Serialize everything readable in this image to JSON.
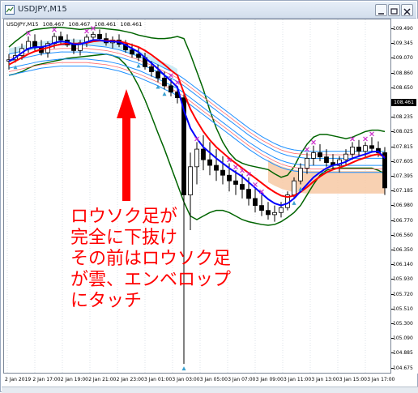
{
  "window": {
    "title": "USDJPY,M15",
    "ohlc": [
      "USDJPY,M15",
      "108.467",
      "108.467",
      "108.461",
      "108.461"
    ]
  },
  "colors": {
    "ma_fast": "#0000ff",
    "ma_slow": "#ff0000",
    "envelope_outer": "#1e90ff",
    "envelope_inner": "#ff7070",
    "bollinger": "#006400",
    "kumo_up": "#c6eaf4",
    "kumo_down": "#f7c9a4",
    "candle": "#000000",
    "arrow_up": "#ff0000",
    "fractal": "#cc33cc",
    "annotation": "#ff0000"
  },
  "y_axis": {
    "labels": [
      "109.490",
      "109.345",
      "109.070",
      "108.860",
      "108.650",
      "108.461",
      "108.235",
      "108.025",
      "107.815",
      "107.605",
      "107.395",
      "107.185",
      "106.980",
      "106.770",
      "106.560",
      "106.350",
      "106.140",
      "105.930",
      "105.720",
      "105.510",
      "105.300",
      "105.090",
      "104.885",
      "104.675"
    ],
    "current_price": "108.461"
  },
  "x_axis": {
    "labels": [
      "2 Jan 2019",
      "2 Jan 17:00",
      "2 Jan 19:00",
      "2 Jan 21:00",
      "2 Jan 23:00",
      "3 Jan 01:00",
      "3 Jan 03:00",
      "3 Jan 05:00",
      "3 Jan 07:00",
      "3 Jan 09:00",
      "3 Jan 11:00",
      "3 Jan 13:00",
      "3 Jan 15:00",
      "3 Jan 17:00"
    ]
  },
  "annotation": {
    "lines": [
      "ロウソク足が",
      "完全に下抜け",
      "その前はロウソク足",
      "が雲、エンベロップ",
      "にタッチ"
    ]
  },
  "chart_data": {
    "type": "candlestick",
    "symbol": "USDJPY",
    "timeframe": "M15",
    "ylim": [
      104.675,
      109.6
    ],
    "x_tick_labels": [
      "2 Jan 2019",
      "2 Jan 17:00",
      "2 Jan 19:00",
      "2 Jan 21:00",
      "2 Jan 23:00",
      "3 Jan 01:00",
      "3 Jan 03:00",
      "3 Jan 05:00",
      "3 Jan 07:00",
      "3 Jan 09:00",
      "3 Jan 11:00",
      "3 Jan 13:00",
      "3 Jan 15:00",
      "3 Jan 17:00"
    ],
    "candles": [
      [
        109.1,
        109.2,
        108.98,
        109.12
      ],
      [
        109.12,
        109.3,
        109.08,
        109.18
      ],
      [
        109.18,
        109.35,
        109.12,
        109.28
      ],
      [
        109.28,
        109.45,
        109.22,
        109.38
      ],
      [
        109.38,
        109.48,
        109.25,
        109.3
      ],
      [
        109.3,
        109.4,
        109.18,
        109.22
      ],
      [
        109.22,
        109.38,
        109.15,
        109.35
      ],
      [
        109.35,
        109.5,
        109.28,
        109.45
      ],
      [
        109.45,
        109.52,
        109.35,
        109.4
      ],
      [
        109.4,
        109.48,
        109.3,
        109.33
      ],
      [
        109.33,
        109.42,
        109.2,
        109.25
      ],
      [
        109.25,
        109.4,
        109.18,
        109.36
      ],
      [
        109.36,
        109.48,
        109.3,
        109.44
      ],
      [
        109.44,
        109.52,
        109.38,
        109.48
      ],
      [
        109.48,
        109.55,
        109.4,
        109.42
      ],
      [
        109.42,
        109.5,
        109.32,
        109.36
      ],
      [
        109.36,
        109.45,
        109.28,
        109.4
      ],
      [
        109.4,
        109.48,
        109.3,
        109.34
      ],
      [
        109.34,
        109.4,
        109.22,
        109.26
      ],
      [
        109.26,
        109.35,
        109.15,
        109.2
      ],
      [
        109.2,
        109.3,
        109.1,
        109.15
      ],
      [
        109.15,
        109.22,
        108.98,
        109.02
      ],
      [
        109.02,
        109.1,
        108.88,
        108.95
      ],
      [
        108.95,
        109.05,
        108.8,
        108.86
      ],
      [
        108.86,
        108.95,
        108.7,
        108.75
      ],
      [
        108.75,
        108.85,
        108.6,
        108.66
      ],
      [
        108.66,
        108.75,
        108.5,
        108.58
      ],
      [
        108.58,
        108.65,
        104.8,
        107.2
      ],
      [
        107.2,
        107.8,
        106.7,
        107.6
      ],
      [
        107.6,
        107.95,
        107.35,
        107.85
      ],
      [
        107.85,
        108.05,
        107.55,
        107.7
      ],
      [
        107.7,
        107.95,
        107.48,
        107.62
      ],
      [
        107.62,
        107.85,
        107.4,
        107.55
      ],
      [
        107.55,
        107.75,
        107.35,
        107.48
      ],
      [
        107.48,
        107.65,
        107.25,
        107.4
      ],
      [
        107.4,
        107.55,
        107.2,
        107.35
      ],
      [
        107.35,
        107.5,
        107.15,
        107.28
      ],
      [
        107.28,
        107.45,
        107.05,
        107.15
      ],
      [
        107.15,
        107.3,
        106.95,
        107.05
      ],
      [
        107.05,
        107.2,
        106.9,
        106.98
      ],
      [
        106.98,
        107.1,
        106.85,
        106.92
      ],
      [
        106.92,
        107.05,
        106.82,
        106.95
      ],
      [
        106.95,
        107.1,
        106.88,
        107.02
      ],
      [
        107.02,
        107.25,
        106.98,
        107.2
      ],
      [
        107.2,
        107.45,
        107.15,
        107.4
      ],
      [
        107.4,
        107.65,
        107.35,
        107.58
      ],
      [
        107.58,
        107.8,
        107.5,
        107.72
      ],
      [
        107.72,
        107.9,
        107.62,
        107.8
      ],
      [
        107.8,
        107.92,
        107.68,
        107.74
      ],
      [
        107.74,
        107.85,
        107.6,
        107.66
      ],
      [
        107.66,
        107.78,
        107.55,
        107.62
      ],
      [
        107.62,
        107.75,
        107.52,
        107.7
      ],
      [
        107.7,
        107.85,
        107.62,
        107.78
      ],
      [
        107.78,
        107.95,
        107.7,
        107.88
      ],
      [
        107.88,
        107.98,
        107.75,
        107.82
      ],
      [
        107.82,
        107.95,
        107.72,
        107.9
      ],
      [
        107.9,
        108.02,
        107.8,
        107.86
      ],
      [
        107.86,
        107.96,
        107.74,
        107.8
      ],
      [
        107.8,
        107.88,
        107.2,
        107.3
      ]
    ],
    "series": [
      {
        "role": "ma_fast",
        "values": [
          109.1,
          109.15,
          109.22,
          109.28,
          109.3,
          109.3,
          109.32,
          109.36,
          109.38,
          109.37,
          109.34,
          109.34,
          109.37,
          109.4,
          109.4,
          109.38,
          109.38,
          109.37,
          109.33,
          109.28,
          109.23,
          109.15,
          109.07,
          108.99,
          108.9,
          108.82,
          108.73,
          108.4,
          108.15,
          108.0,
          107.88,
          107.8,
          107.72,
          107.65,
          107.58,
          107.52,
          107.46,
          107.38,
          107.3,
          107.22,
          107.14,
          107.08,
          107.05,
          107.08,
          107.15,
          107.25,
          107.35,
          107.45,
          107.52,
          107.58,
          107.62,
          107.64,
          107.67,
          107.72,
          107.75,
          107.78,
          107.81,
          107.82,
          107.72
        ]
      },
      {
        "role": "ma_slow",
        "values": [
          109.05,
          109.1,
          109.15,
          109.2,
          109.24,
          109.27,
          109.29,
          109.32,
          109.34,
          109.35,
          109.35,
          109.35,
          109.36,
          109.38,
          109.39,
          109.39,
          109.39,
          109.38,
          109.36,
          109.33,
          109.3,
          109.25,
          109.19,
          109.12,
          109.05,
          108.97,
          108.9,
          108.65,
          108.42,
          108.25,
          108.1,
          107.98,
          107.88,
          107.8,
          107.72,
          107.65,
          107.58,
          107.51,
          107.44,
          107.37,
          107.3,
          107.24,
          107.19,
          107.17,
          107.19,
          107.24,
          107.31,
          107.39,
          107.46,
          107.52,
          107.56,
          107.59,
          107.62,
          107.66,
          107.7,
          107.73,
          107.76,
          107.78,
          107.74
        ]
      },
      {
        "role": "envelope_upper",
        "values": [
          109.2,
          109.22,
          109.24,
          109.26,
          109.28,
          109.3,
          109.31,
          109.32,
          109.33,
          109.33,
          109.33,
          109.33,
          109.33,
          109.32,
          109.31,
          109.3,
          109.28,
          109.26,
          109.23,
          109.2,
          109.17,
          109.13,
          109.09,
          109.05,
          109.0,
          108.96,
          108.91,
          108.85,
          108.78,
          108.71,
          108.64,
          108.57,
          108.5,
          108.43,
          108.36,
          108.29,
          108.22,
          108.15,
          108.09,
          108.03,
          107.98,
          107.93,
          107.89,
          107.86,
          107.84,
          107.83,
          107.82,
          107.82,
          107.82,
          107.82,
          107.82,
          107.82,
          107.82,
          107.82,
          107.82,
          107.82,
          107.82,
          107.82,
          107.82
        ]
      },
      {
        "role": "envelope_lower",
        "values": [
          108.9,
          108.92,
          108.94,
          108.96,
          108.98,
          109.0,
          109.01,
          109.02,
          109.03,
          109.03,
          109.03,
          109.03,
          109.03,
          109.02,
          109.01,
          109.0,
          108.98,
          108.96,
          108.93,
          108.9,
          108.87,
          108.83,
          108.79,
          108.75,
          108.7,
          108.66,
          108.61,
          108.55,
          108.48,
          108.41,
          108.34,
          108.27,
          108.2,
          108.13,
          108.06,
          107.99,
          107.92,
          107.85,
          107.79,
          107.73,
          107.68,
          107.63,
          107.59,
          107.56,
          107.54,
          107.53,
          107.52,
          107.52,
          107.52,
          107.52,
          107.52,
          107.52,
          107.52,
          107.52,
          107.52,
          107.52,
          107.52,
          107.52,
          107.52
        ]
      },
      {
        "role": "bollinger_upper",
        "values": [
          109.3,
          109.38,
          109.45,
          109.52,
          109.55,
          109.56,
          109.57,
          109.58,
          109.58,
          109.57,
          109.56,
          109.55,
          109.56,
          109.57,
          109.57,
          109.56,
          109.55,
          109.54,
          109.52,
          109.5,
          109.47,
          109.45,
          109.43,
          109.42,
          109.42,
          109.43,
          109.45,
          109.42,
          109.2,
          108.95,
          108.7,
          108.4,
          108.15,
          107.95,
          107.8,
          107.7,
          107.65,
          107.62,
          107.6,
          107.58,
          107.56,
          107.5,
          107.45,
          107.48,
          107.6,
          107.78,
          107.92,
          108.02,
          108.06,
          108.06,
          108.04,
          108.02,
          108.0,
          108.02,
          108.06,
          108.1,
          108.12,
          108.12,
          108.1
        ]
      },
      {
        "role": "bollinger_lower",
        "values": [
          108.9,
          108.92,
          108.95,
          109.0,
          109.04,
          109.06,
          109.08,
          109.1,
          109.12,
          109.14,
          109.15,
          109.16,
          109.17,
          109.18,
          109.19,
          109.2,
          109.18,
          109.14,
          109.05,
          108.92,
          108.75,
          108.55,
          108.32,
          108.08,
          107.85,
          107.6,
          107.35,
          107.1,
          106.9,
          106.85,
          106.9,
          106.95,
          106.98,
          106.98,
          106.95,
          106.9,
          106.85,
          106.82,
          106.8,
          106.78,
          106.77,
          106.78,
          106.82,
          106.88,
          106.95,
          107.05,
          107.2,
          107.35,
          107.48,
          107.55,
          107.58,
          107.58,
          107.58,
          107.58,
          107.58,
          107.58,
          107.58,
          107.55,
          107.5
        ]
      }
    ]
  }
}
